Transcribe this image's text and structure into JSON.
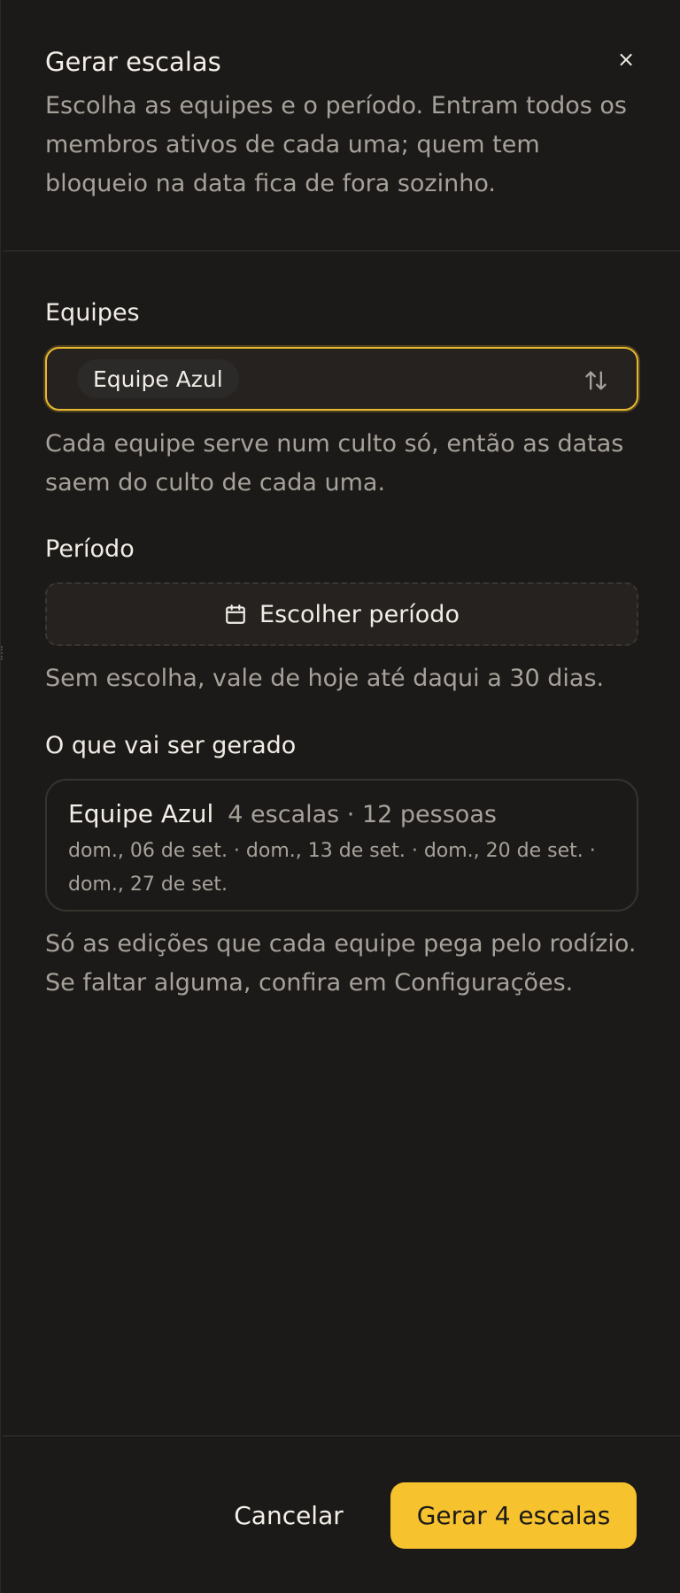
{
  "dialog": {
    "title": "Gerar escalas",
    "close_label": "×",
    "description": "Escolha as equipes e o período. Entram todos os membros ativos de cada uma; quem tem bloqueio na data fica de fora sozinho."
  },
  "teams": {
    "label": "Equipes",
    "selected": [
      "Equipe Azul"
    ],
    "icon": "sort-icon",
    "hint": "Cada equipe serve num culto só, então as datas saem do culto de cada uma."
  },
  "period": {
    "label": "Período",
    "button_label": "Escolher período",
    "icon": "calendar-icon",
    "hint": "Sem escolha, vale de hoje até daqui a 30 dias."
  },
  "summary": {
    "label": "O que vai ser gerado",
    "items": [
      {
        "team": "Equipe Azul",
        "counts": "4 escalas · 12 pessoas",
        "dates": "dom., 06 de set. · dom., 13 de set. · dom., 20 de set. · dom., 27 de set."
      }
    ],
    "hint": "Só as edições que cada equipe pega pelo rodízio. Se faltar alguma, confira em Configurações."
  },
  "footer": {
    "cancel_label": "Cancelar",
    "submit_label": "Gerar 4 escalas"
  },
  "colors": {
    "background": "#1c1a18",
    "accent": "#f6c22e",
    "focus_ring": "#e8b92e",
    "muted_text": "#a6a19a"
  }
}
